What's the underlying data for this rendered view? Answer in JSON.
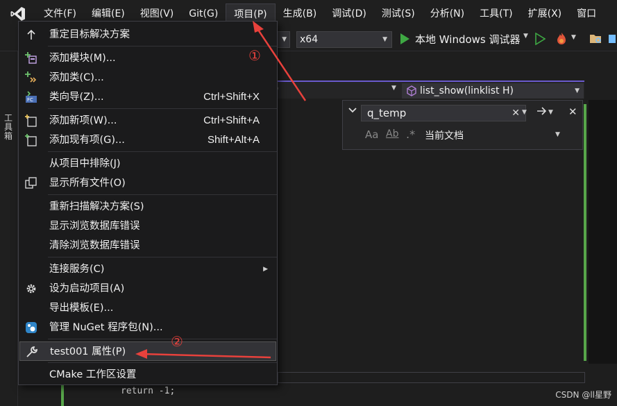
{
  "menubar": {
    "items": [
      {
        "label": "文件(F)"
      },
      {
        "label": "编辑(E)"
      },
      {
        "label": "视图(V)"
      },
      {
        "label": "Git(G)"
      },
      {
        "label": "项目(P)",
        "active": true
      },
      {
        "label": "生成(B)"
      },
      {
        "label": "调试(D)"
      },
      {
        "label": "测试(S)"
      },
      {
        "label": "分析(N)"
      },
      {
        "label": "工具(T)"
      },
      {
        "label": "扩展(X)"
      },
      {
        "label": "窗口"
      }
    ]
  },
  "toolbar": {
    "platform": "x64",
    "debugger": "本地 Windows 调试器"
  },
  "side_panel": {
    "label": "工具箱"
  },
  "nav_bar": {
    "member": "list_show(linklist H)"
  },
  "find": {
    "query": "q_temp",
    "scope": "当前文档",
    "case_icon": "Aa",
    "word_icon": "Ab"
  },
  "project_menu": {
    "items": [
      {
        "label": "重定目标解决方案",
        "shortcut": "",
        "icon": "arrow-up-icon"
      },
      {
        "label": "添加模块(M)...",
        "shortcut": "",
        "icon": "add-module-icon"
      },
      {
        "label": "添加类(C)...",
        "shortcut": "",
        "icon": "add-class-icon"
      },
      {
        "label": "类向导(Z)...",
        "shortcut": "Ctrl+Shift+X",
        "icon": "class-wizard-icon"
      },
      {
        "label": "添加新项(W)...",
        "shortcut": "Ctrl+Shift+A",
        "icon": "add-new-item-icon"
      },
      {
        "label": "添加现有项(G)...",
        "shortcut": "Shift+Alt+A",
        "icon": "add-existing-item-icon"
      },
      {
        "label": "从项目中排除(J)",
        "shortcut": "",
        "icon": ""
      },
      {
        "label": "显示所有文件(O)",
        "shortcut": "",
        "icon": "show-all-files-icon"
      },
      {
        "label": "重新扫描解决方案(S)",
        "shortcut": "",
        "icon": ""
      },
      {
        "label": "显示浏览数据库错误",
        "shortcut": "",
        "icon": ""
      },
      {
        "label": "清除浏览数据库错误",
        "shortcut": "",
        "icon": ""
      },
      {
        "label": "连接服务(C)",
        "shortcut": "",
        "icon": "",
        "submenu": true
      },
      {
        "label": "设为启动项目(A)",
        "shortcut": "",
        "icon": "gear-icon"
      },
      {
        "label": "导出模板(E)...",
        "shortcut": "",
        "icon": ""
      },
      {
        "label": "管理 NuGet 程序包(N)...",
        "shortcut": "",
        "icon": "nuget-icon"
      },
      {
        "label": "test001 属性(P)",
        "shortcut": "",
        "icon": "wrench-icon",
        "highlighted": true
      },
      {
        "label": "CMake 工作区设置",
        "shortcut": "",
        "icon": ""
      }
    ]
  },
  "annotations": {
    "one": "①",
    "two": "②"
  },
  "code": {
    "line": "return -1;"
  },
  "watermark": "CSDN @ll星野",
  "colors": {
    "accent": "#6a5acd",
    "annotation": "#e8413c",
    "play_green": "#3ea843",
    "menu_bg": "#1b1b1c"
  }
}
